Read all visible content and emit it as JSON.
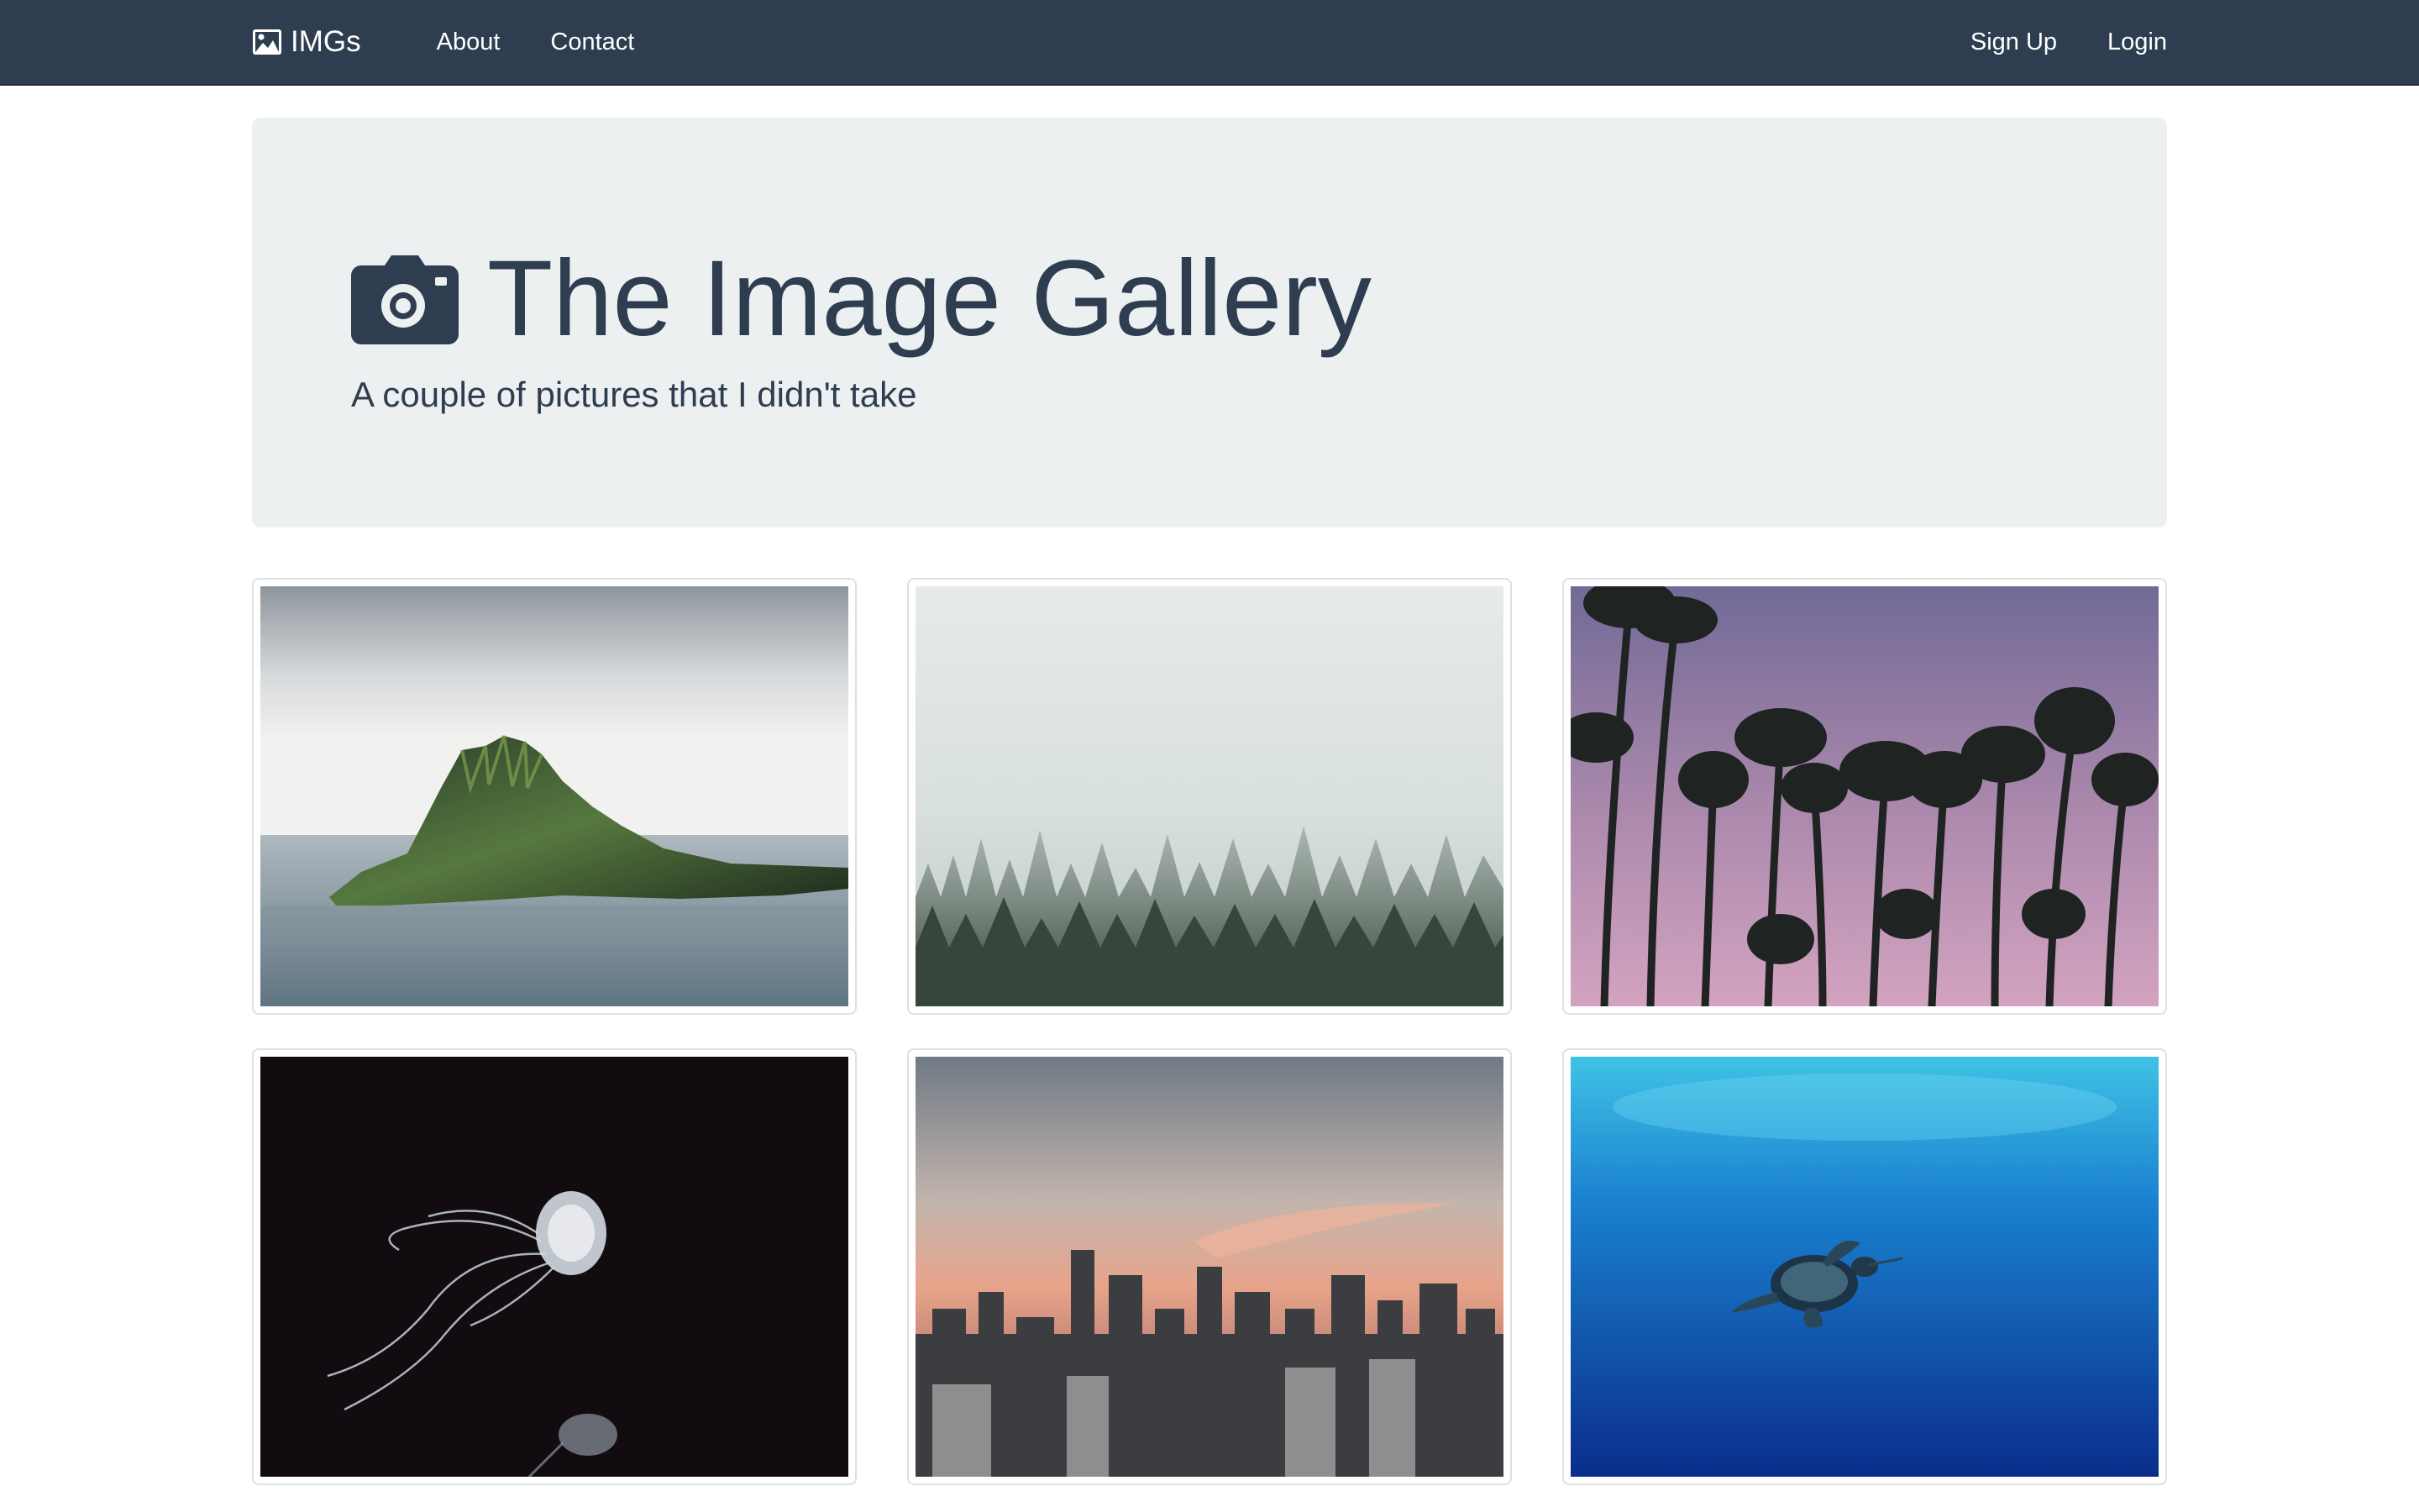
{
  "navbar": {
    "brand": "IMGs",
    "brand_icon": "picture-icon",
    "links_left": [
      "About",
      "Contact"
    ],
    "links_right": [
      "Sign Up",
      "Login"
    ],
    "background": "#2e3d4f"
  },
  "jumbotron": {
    "icon": "camera-icon",
    "title": "The Image Gallery",
    "subtitle": "A couple of pictures that I didn't take",
    "background": "#ecf0f1",
    "text_color": "#2e3d4f"
  },
  "gallery": {
    "images": [
      {
        "subject": "island-in-sea"
      },
      {
        "subject": "misty-pine-forest"
      },
      {
        "subject": "palm-trees-at-dusk"
      },
      {
        "subject": "jellyfish"
      },
      {
        "subject": "city-skyline-at-sunset"
      },
      {
        "subject": "sea-turtle-underwater"
      }
    ]
  }
}
